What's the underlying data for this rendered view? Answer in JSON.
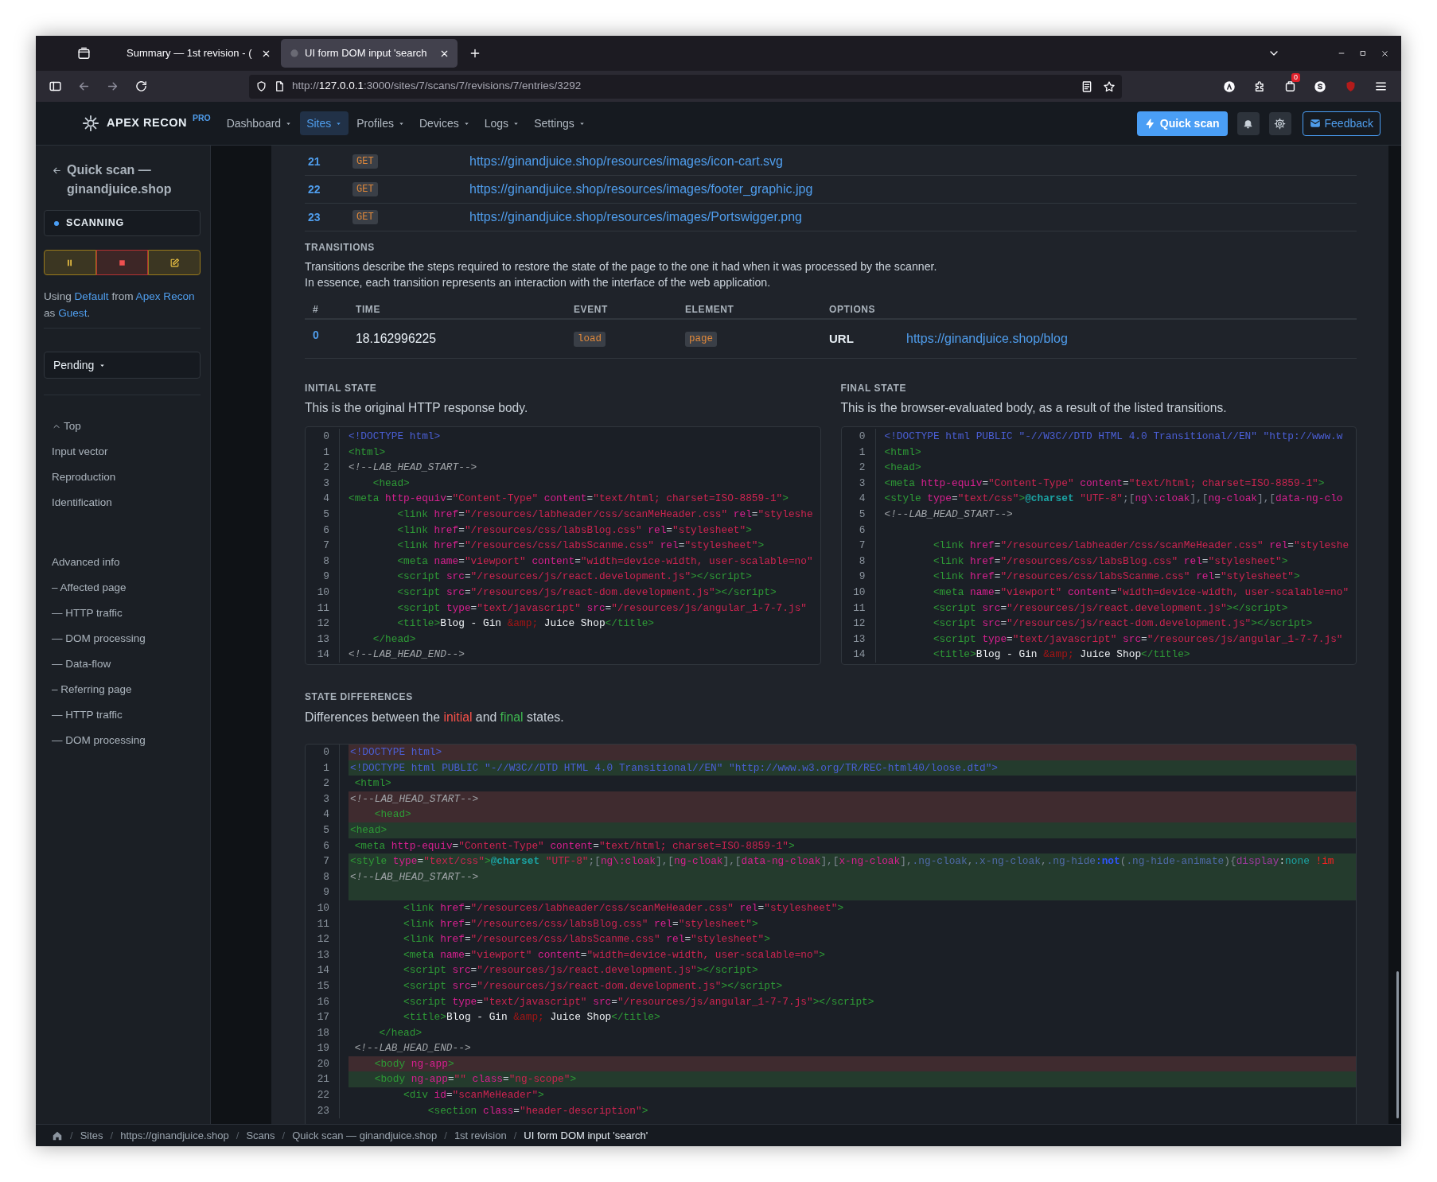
{
  "browser": {
    "tabs": [
      {
        "title": "Summary — 1st revision - (",
        "selected": false
      },
      {
        "title": "UI form DOM input 'search",
        "selected": true
      }
    ],
    "url": {
      "scheme": "http://",
      "host": "127.0.0.1",
      "path": ":3000/sites/7/scans/7/revisions/7/entries/3292"
    },
    "extension_badge": "0"
  },
  "app": {
    "brand": "APEX RECON",
    "edition": "PRO",
    "menu": [
      {
        "label": "Dashboard",
        "selected": false
      },
      {
        "label": "Sites",
        "selected": true
      },
      {
        "label": "Profiles",
        "selected": false
      },
      {
        "label": "Devices",
        "selected": false
      },
      {
        "label": "Logs",
        "selected": false
      },
      {
        "label": "Settings",
        "selected": false
      }
    ],
    "quick_scan": "Quick scan",
    "feedback": "Feedback"
  },
  "sidebar": {
    "title": "Quick scan — ginandjuice.shop",
    "status": "SCANNING",
    "using": [
      {
        "text": "Using ",
        "link": false
      },
      {
        "text": "Default",
        "link": true
      },
      {
        "text": " from ",
        "link": false
      },
      {
        "text": "Apex Recon",
        "link": true
      },
      {
        "text": " as ",
        "link": false
      },
      {
        "text": "Guest",
        "link": true
      },
      {
        "text": ".",
        "link": false
      }
    ],
    "filter": "Pending",
    "sections": [
      {
        "items": [
          {
            "label": "Top",
            "kind": "top"
          },
          {
            "label": "Input vector",
            "kind": "link"
          },
          {
            "label": "Reproduction",
            "kind": "link"
          },
          {
            "label": "Identification",
            "kind": "link"
          }
        ]
      },
      {
        "items": [
          {
            "label": "Advanced info",
            "kind": "link"
          },
          {
            "label": "– Affected page",
            "kind": "link"
          },
          {
            "label": "— HTTP traffic",
            "kind": "link"
          },
          {
            "label": "— DOM processing",
            "kind": "link"
          },
          {
            "label": "— Data-flow",
            "kind": "link"
          },
          {
            "label": "– Referring page",
            "kind": "link"
          },
          {
            "label": "— HTTP traffic",
            "kind": "link"
          },
          {
            "label": "— DOM processing",
            "kind": "link"
          }
        ]
      }
    ]
  },
  "requests": [
    {
      "no": "21",
      "method": "GET",
      "url": "https://ginandjuice.shop/resources/images/icon-cart.svg"
    },
    {
      "no": "22",
      "method": "GET",
      "url": "https://ginandjuice.shop/resources/images/footer_graphic.jpg"
    },
    {
      "no": "23",
      "method": "GET",
      "url": "https://ginandjuice.shop/resources/images/Portswigger.png"
    }
  ],
  "transitions": {
    "heading": "TRANSITIONS",
    "description": [
      "Transitions describe the steps required to restore the state of the page to the one it had when it was processed by the scanner.",
      "In essence, each transition represents an interaction with the interface of the web application."
    ],
    "columns": [
      "#",
      "TIME",
      "EVENT",
      "ELEMENT",
      "OPTIONS"
    ],
    "rows": [
      {
        "index": "0",
        "time": "18.162996225",
        "event": "load",
        "element": "page",
        "option_key": "URL",
        "option_value": "https://ginandjuice.shop/blog"
      }
    ]
  },
  "initial_state": {
    "heading": "INITIAL STATE",
    "description": "This is the original HTTP response body.",
    "lines": [
      {
        "no": "0",
        "code": [
          {
            "kind": "doctype",
            "text": "<!DOCTYPE html>"
          }
        ]
      },
      {
        "no": "1",
        "code": [
          {
            "kind": "tag",
            "text": "<html>"
          }
        ]
      },
      {
        "no": "2",
        "code": [
          {
            "kind": "comment",
            "text": "<!--LAB_HEAD_START-->"
          }
        ]
      },
      {
        "no": "3",
        "code": [
          {
            "kind": "tag",
            "text": "    <head>"
          }
        ]
      },
      {
        "no": "4",
        "code": [
          {
            "kind": "tag",
            "text": "<meta "
          },
          {
            "kind": "attr",
            "text": "http-equiv"
          },
          {
            "kind": "punct",
            "text": "="
          },
          {
            "kind": "value",
            "text": "\"Content-Type\""
          },
          {
            "kind": "attr",
            "text": " content"
          },
          {
            "kind": "punct",
            "text": "="
          },
          {
            "kind": "value",
            "text": "\"text/html; charset=ISO-8859-1\""
          },
          {
            "kind": "tag",
            "text": ">"
          }
        ]
      },
      {
        "no": "5",
        "code": [
          {
            "kind": "tag",
            "text": "        <link "
          },
          {
            "kind": "attr",
            "text": "href"
          },
          {
            "kind": "punct",
            "text": "="
          },
          {
            "kind": "value",
            "text": "\"/resources/labheader/css/scanMeHeader.css\""
          },
          {
            "kind": "attr",
            "text": " rel"
          },
          {
            "kind": "punct",
            "text": "="
          },
          {
            "kind": "value",
            "text": "\"styleshe"
          }
        ]
      },
      {
        "no": "6",
        "code": [
          {
            "kind": "tag",
            "text": "        <link "
          },
          {
            "kind": "attr",
            "text": "href"
          },
          {
            "kind": "punct",
            "text": "="
          },
          {
            "kind": "value",
            "text": "\"/resources/css/labsBlog.css\""
          },
          {
            "kind": "attr",
            "text": " rel"
          },
          {
            "kind": "punct",
            "text": "="
          },
          {
            "kind": "value",
            "text": "\"stylesheet\""
          },
          {
            "kind": "tag",
            "text": ">"
          }
        ]
      },
      {
        "no": "7",
        "code": [
          {
            "kind": "tag",
            "text": "        <link "
          },
          {
            "kind": "attr",
            "text": "href"
          },
          {
            "kind": "punct",
            "text": "="
          },
          {
            "kind": "value",
            "text": "\"/resources/css/labsScanme.css\""
          },
          {
            "kind": "attr",
            "text": " rel"
          },
          {
            "kind": "punct",
            "text": "="
          },
          {
            "kind": "value",
            "text": "\"stylesheet\""
          },
          {
            "kind": "tag",
            "text": ">"
          }
        ]
      },
      {
        "no": "8",
        "code": [
          {
            "kind": "tag",
            "text": "        <meta "
          },
          {
            "kind": "attr",
            "text": "name"
          },
          {
            "kind": "punct",
            "text": "="
          },
          {
            "kind": "value",
            "text": "\"viewport\""
          },
          {
            "kind": "attr",
            "text": " content"
          },
          {
            "kind": "punct",
            "text": "="
          },
          {
            "kind": "value",
            "text": "\"width=device-width, user-scalable=no\""
          }
        ]
      },
      {
        "no": "9",
        "code": [
          {
            "kind": "tag",
            "text": "        <script "
          },
          {
            "kind": "attr",
            "text": "src"
          },
          {
            "kind": "punct",
            "text": "="
          },
          {
            "kind": "value",
            "text": "\"/resources/js/react.development.js\""
          },
          {
            "kind": "tag",
            "text": "></script>"
          }
        ]
      },
      {
        "no": "10",
        "code": [
          {
            "kind": "tag",
            "text": "        <script "
          },
          {
            "kind": "attr",
            "text": "src"
          },
          {
            "kind": "punct",
            "text": "="
          },
          {
            "kind": "value",
            "text": "\"/resources/js/react-dom.development.js\""
          },
          {
            "kind": "tag",
            "text": "></script>"
          }
        ]
      },
      {
        "no": "11",
        "code": [
          {
            "kind": "tag",
            "text": "        <script "
          },
          {
            "kind": "attr",
            "text": "type"
          },
          {
            "kind": "punct",
            "text": "="
          },
          {
            "kind": "value",
            "text": "\"text/javascript\""
          },
          {
            "kind": "attr",
            "text": " src"
          },
          {
            "kind": "punct",
            "text": "="
          },
          {
            "kind": "value",
            "text": "\"/resources/js/angular_1-7-7.js\""
          }
        ]
      },
      {
        "no": "12",
        "code": [
          {
            "kind": "tag",
            "text": "        <title>"
          },
          {
            "kind": "text",
            "text": "Blog - Gin "
          },
          {
            "kind": "entity",
            "text": "&amp;"
          },
          {
            "kind": "text",
            "text": " Juice Shop"
          },
          {
            "kind": "tag",
            "text": "</title>"
          }
        ]
      },
      {
        "no": "13",
        "code": [
          {
            "kind": "tag",
            "text": "    </head>"
          }
        ]
      },
      {
        "no": "14",
        "code": [
          {
            "kind": "comment",
            "text": "<!--LAB_HEAD_END-->"
          }
        ]
      }
    ]
  },
  "final_state": {
    "heading": "FINAL STATE",
    "description": "This is the browser-evaluated body, as a result of the listed transitions.",
    "lines": [
      {
        "no": "0",
        "code": [
          {
            "kind": "doctype",
            "text": "<!DOCTYPE html PUBLIC \"-//W3C//DTD HTML 4.0 Transitional//EN\" \"http://www.w"
          }
        ]
      },
      {
        "no": "1",
        "code": [
          {
            "kind": "tag",
            "text": "<html>"
          }
        ]
      },
      {
        "no": "2",
        "code": [
          {
            "kind": "tag",
            "text": "<head>"
          }
        ]
      },
      {
        "no": "3",
        "code": [
          {
            "kind": "tag",
            "text": "<meta "
          },
          {
            "kind": "attr",
            "text": "http-equiv"
          },
          {
            "kind": "punct",
            "text": "="
          },
          {
            "kind": "value",
            "text": "\"Content-Type\""
          },
          {
            "kind": "attr",
            "text": " content"
          },
          {
            "kind": "punct",
            "text": "="
          },
          {
            "kind": "value",
            "text": "\"text/html; charset=ISO-8859-1\""
          },
          {
            "kind": "tag",
            "text": ">"
          }
        ]
      },
      {
        "no": "4",
        "code": [
          {
            "kind": "tag",
            "text": "<style "
          },
          {
            "kind": "attr",
            "text": "type"
          },
          {
            "kind": "punct",
            "text": "="
          },
          {
            "kind": "value",
            "text": "\"text/css\""
          },
          {
            "kind": "tag",
            "text": ">"
          },
          {
            "kind": "keyword",
            "text": "@charset"
          },
          {
            "kind": "value",
            "text": " \"UTF-8\""
          },
          {
            "kind": "bracket",
            "text": ";["
          },
          {
            "kind": "attr",
            "text": "ng\\:cloak"
          },
          {
            "kind": "bracket",
            "text": "],["
          },
          {
            "kind": "attr",
            "text": "ng-cloak"
          },
          {
            "kind": "bracket",
            "text": "],["
          },
          {
            "kind": "attr",
            "text": "data-ng-clo"
          }
        ]
      },
      {
        "no": "5",
        "code": [
          {
            "kind": "comment",
            "text": "<!--LAB_HEAD_START-->"
          }
        ]
      },
      {
        "no": "6"
      },
      {
        "no": "7",
        "code": [
          {
            "kind": "tag",
            "text": "        <link "
          },
          {
            "kind": "attr",
            "text": "href"
          },
          {
            "kind": "punct",
            "text": "="
          },
          {
            "kind": "value",
            "text": "\"/resources/labheader/css/scanMeHeader.css\""
          },
          {
            "kind": "attr",
            "text": " rel"
          },
          {
            "kind": "punct",
            "text": "="
          },
          {
            "kind": "value",
            "text": "\"styleshe"
          }
        ]
      },
      {
        "no": "8",
        "code": [
          {
            "kind": "tag",
            "text": "        <link "
          },
          {
            "kind": "attr",
            "text": "href"
          },
          {
            "kind": "punct",
            "text": "="
          },
          {
            "kind": "value",
            "text": "\"/resources/css/labsBlog.css\""
          },
          {
            "kind": "attr",
            "text": " rel"
          },
          {
            "kind": "punct",
            "text": "="
          },
          {
            "kind": "value",
            "text": "\"stylesheet\""
          },
          {
            "kind": "tag",
            "text": ">"
          }
        ]
      },
      {
        "no": "9",
        "code": [
          {
            "kind": "tag",
            "text": "        <link "
          },
          {
            "kind": "attr",
            "text": "href"
          },
          {
            "kind": "punct",
            "text": "="
          },
          {
            "kind": "value",
            "text": "\"/resources/css/labsScanme.css\""
          },
          {
            "kind": "attr",
            "text": " rel"
          },
          {
            "kind": "punct",
            "text": "="
          },
          {
            "kind": "value",
            "text": "\"stylesheet\""
          },
          {
            "kind": "tag",
            "text": ">"
          }
        ]
      },
      {
        "no": "10",
        "code": [
          {
            "kind": "tag",
            "text": "        <meta "
          },
          {
            "kind": "attr",
            "text": "name"
          },
          {
            "kind": "punct",
            "text": "="
          },
          {
            "kind": "value",
            "text": "\"viewport\""
          },
          {
            "kind": "attr",
            "text": " content"
          },
          {
            "kind": "punct",
            "text": "="
          },
          {
            "kind": "value",
            "text": "\"width=device-width, user-scalable=no\""
          }
        ]
      },
      {
        "no": "11",
        "code": [
          {
            "kind": "tag",
            "text": "        <script "
          },
          {
            "kind": "attr",
            "text": "src"
          },
          {
            "kind": "punct",
            "text": "="
          },
          {
            "kind": "value",
            "text": "\"/resources/js/react.development.js\""
          },
          {
            "kind": "tag",
            "text": "></script>"
          }
        ]
      },
      {
        "no": "12",
        "code": [
          {
            "kind": "tag",
            "text": "        <script "
          },
          {
            "kind": "attr",
            "text": "src"
          },
          {
            "kind": "punct",
            "text": "="
          },
          {
            "kind": "value",
            "text": "\"/resources/js/react-dom.development.js\""
          },
          {
            "kind": "tag",
            "text": "></script>"
          }
        ]
      },
      {
        "no": "13",
        "code": [
          {
            "kind": "tag",
            "text": "        <script "
          },
          {
            "kind": "attr",
            "text": "type"
          },
          {
            "kind": "punct",
            "text": "="
          },
          {
            "kind": "value",
            "text": "\"text/javascript\""
          },
          {
            "kind": "attr",
            "text": " src"
          },
          {
            "kind": "punct",
            "text": "="
          },
          {
            "kind": "value",
            "text": "\"/resources/js/angular_1-7-7.js\""
          }
        ]
      },
      {
        "no": "14",
        "code": [
          {
            "kind": "tag",
            "text": "        <title>"
          },
          {
            "kind": "text",
            "text": "Blog - Gin "
          },
          {
            "kind": "entity",
            "text": "&amp;"
          },
          {
            "kind": "text",
            "text": " Juice Shop"
          },
          {
            "kind": "tag",
            "text": "</title>"
          }
        ]
      }
    ]
  },
  "state_differences": {
    "heading": "STATE DIFFERENCES",
    "description": [
      {
        "text": "Differences between the ",
        "kind": "plain"
      },
      {
        "text": "initial",
        "kind": "removed"
      },
      {
        "text": " and ",
        "kind": "plain"
      },
      {
        "text": "final",
        "kind": "added"
      },
      {
        "text": " states.",
        "kind": "plain"
      }
    ],
    "lines": [
      {
        "no": "0",
        "kind": "removed",
        "code": [
          {
            "kind": "doctype",
            "text": "<!DOCTYPE html>"
          }
        ]
      },
      {
        "no": "1",
        "kind": "added",
        "code": [
          {
            "kind": "doctype",
            "text": "<!DOCTYPE html PUBLIC \"-//W3C//DTD HTML 4.0 Transitional//EN\" \"http://www.w3.org/TR/REC-html40/loose.dtd\">"
          }
        ]
      },
      {
        "no": "2",
        "kind": "same",
        "code": [
          {
            "kind": "tag",
            "text": " <html>"
          }
        ]
      },
      {
        "no": "3",
        "kind": "removed",
        "code": [
          {
            "kind": "comment",
            "text": "<!--LAB_HEAD_START-->"
          }
        ]
      },
      {
        "no": "4",
        "kind": "removed",
        "code": [
          {
            "kind": "tag",
            "text": "    <head>"
          }
        ]
      },
      {
        "no": "5",
        "kind": "added",
        "code": [
          {
            "kind": "tag",
            "text": "<head>"
          }
        ]
      },
      {
        "no": "6",
        "kind": "same",
        "code": [
          {
            "kind": "tag",
            "text": " <meta "
          },
          {
            "kind": "attr",
            "text": "http-equiv"
          },
          {
            "kind": "punct",
            "text": "="
          },
          {
            "kind": "value",
            "text": "\"Content-Type\""
          },
          {
            "kind": "attr",
            "text": " content"
          },
          {
            "kind": "punct",
            "text": "="
          },
          {
            "kind": "value",
            "text": "\"text/html; charset=ISO-8859-1\""
          },
          {
            "kind": "tag",
            "text": ">"
          }
        ]
      },
      {
        "no": "7",
        "kind": "added",
        "code": [
          {
            "kind": "tag",
            "text": "<style "
          },
          {
            "kind": "attr",
            "text": "type"
          },
          {
            "kind": "punct",
            "text": "="
          },
          {
            "kind": "value",
            "text": "\"text/css\""
          },
          {
            "kind": "tag",
            "text": ">"
          },
          {
            "kind": "keyword",
            "text": "@charset"
          },
          {
            "kind": "value",
            "text": " \"UTF-8\""
          },
          {
            "kind": "bracket",
            "text": ";["
          },
          {
            "kind": "attr",
            "text": "ng\\:cloak"
          },
          {
            "kind": "bracket",
            "text": "],["
          },
          {
            "kind": "attr",
            "text": "ng-cloak"
          },
          {
            "kind": "bracket",
            "text": "],["
          },
          {
            "kind": "attr",
            "text": "data-ng-cloak"
          },
          {
            "kind": "bracket",
            "text": "],["
          },
          {
            "kind": "attr",
            "text": "x-ng-cloak"
          },
          {
            "kind": "bracket",
            "text": "],"
          },
          {
            "kind": "selector",
            "text": ".ng-cloak"
          },
          {
            "kind": "bracket",
            "text": ","
          },
          {
            "kind": "selector",
            "text": ".x-ng-cloak"
          },
          {
            "kind": "bracket",
            "text": ","
          },
          {
            "kind": "selector",
            "text": ".ng-hide"
          },
          {
            "kind": "pseudo",
            "text": ":not"
          },
          {
            "kind": "bracket",
            "text": "("
          },
          {
            "kind": "selector",
            "text": ".ng-hide-animate"
          },
          {
            "kind": "bracket",
            "text": "){"
          },
          {
            "kind": "property",
            "text": "display"
          },
          {
            "kind": "punct",
            "text": ":"
          },
          {
            "kind": "constant",
            "text": "none"
          },
          {
            "kind": "important",
            "text": " !im"
          }
        ]
      },
      {
        "no": "8",
        "kind": "added",
        "code": [
          {
            "kind": "comment",
            "text": "<!--LAB_HEAD_START-->"
          }
        ]
      },
      {
        "no": "9",
        "kind": "added"
      },
      {
        "no": "10",
        "kind": "same",
        "code": [
          {
            "kind": "tag",
            "text": "         <link "
          },
          {
            "kind": "attr",
            "text": "href"
          },
          {
            "kind": "punct",
            "text": "="
          },
          {
            "kind": "value",
            "text": "\"/resources/labheader/css/scanMeHeader.css\""
          },
          {
            "kind": "attr",
            "text": " rel"
          },
          {
            "kind": "punct",
            "text": "="
          },
          {
            "kind": "value",
            "text": "\"stylesheet\""
          },
          {
            "kind": "tag",
            "text": ">"
          }
        ]
      },
      {
        "no": "11",
        "kind": "same",
        "code": [
          {
            "kind": "tag",
            "text": "         <link "
          },
          {
            "kind": "attr",
            "text": "href"
          },
          {
            "kind": "punct",
            "text": "="
          },
          {
            "kind": "value",
            "text": "\"/resources/css/labsBlog.css\""
          },
          {
            "kind": "attr",
            "text": " rel"
          },
          {
            "kind": "punct",
            "text": "="
          },
          {
            "kind": "value",
            "text": "\"stylesheet\""
          },
          {
            "kind": "tag",
            "text": ">"
          }
        ]
      },
      {
        "no": "12",
        "kind": "same",
        "code": [
          {
            "kind": "tag",
            "text": "         <link "
          },
          {
            "kind": "attr",
            "text": "href"
          },
          {
            "kind": "punct",
            "text": "="
          },
          {
            "kind": "value",
            "text": "\"/resources/css/labsScanme.css\""
          },
          {
            "kind": "attr",
            "text": " rel"
          },
          {
            "kind": "punct",
            "text": "="
          },
          {
            "kind": "value",
            "text": "\"stylesheet\""
          },
          {
            "kind": "tag",
            "text": ">"
          }
        ]
      },
      {
        "no": "13",
        "kind": "same",
        "code": [
          {
            "kind": "tag",
            "text": "         <meta "
          },
          {
            "kind": "attr",
            "text": "name"
          },
          {
            "kind": "punct",
            "text": "="
          },
          {
            "kind": "value",
            "text": "\"viewport\""
          },
          {
            "kind": "attr",
            "text": " content"
          },
          {
            "kind": "punct",
            "text": "="
          },
          {
            "kind": "value",
            "text": "\"width=device-width, user-scalable=no\""
          },
          {
            "kind": "tag",
            "text": ">"
          }
        ]
      },
      {
        "no": "14",
        "kind": "same",
        "code": [
          {
            "kind": "tag",
            "text": "         <script "
          },
          {
            "kind": "attr",
            "text": "src"
          },
          {
            "kind": "punct",
            "text": "="
          },
          {
            "kind": "value",
            "text": "\"/resources/js/react.development.js\""
          },
          {
            "kind": "tag",
            "text": "></script>"
          }
        ]
      },
      {
        "no": "15",
        "kind": "same",
        "code": [
          {
            "kind": "tag",
            "text": "         <script "
          },
          {
            "kind": "attr",
            "text": "src"
          },
          {
            "kind": "punct",
            "text": "="
          },
          {
            "kind": "value",
            "text": "\"/resources/js/react-dom.development.js\""
          },
          {
            "kind": "tag",
            "text": "></script>"
          }
        ]
      },
      {
        "no": "16",
        "kind": "same",
        "code": [
          {
            "kind": "tag",
            "text": "         <script "
          },
          {
            "kind": "attr",
            "text": "type"
          },
          {
            "kind": "punct",
            "text": "="
          },
          {
            "kind": "value",
            "text": "\"text/javascript\""
          },
          {
            "kind": "attr",
            "text": " src"
          },
          {
            "kind": "punct",
            "text": "="
          },
          {
            "kind": "value",
            "text": "\"/resources/js/angular_1-7-7.js\""
          },
          {
            "kind": "tag",
            "text": "></script>"
          }
        ]
      },
      {
        "no": "17",
        "kind": "same",
        "code": [
          {
            "kind": "tag",
            "text": "         <title>"
          },
          {
            "kind": "text",
            "text": "Blog - Gin "
          },
          {
            "kind": "entity",
            "text": "&amp;"
          },
          {
            "kind": "text",
            "text": " Juice Shop"
          },
          {
            "kind": "tag",
            "text": "</title>"
          }
        ]
      },
      {
        "no": "18",
        "kind": "same",
        "code": [
          {
            "kind": "tag",
            "text": "     </head>"
          }
        ]
      },
      {
        "no": "19",
        "kind": "same",
        "code": [
          {
            "kind": "comment",
            "text": " <!--LAB_HEAD_END-->"
          }
        ]
      },
      {
        "no": "20",
        "kind": "removed",
        "code": [
          {
            "kind": "tag",
            "text": "    <body "
          },
          {
            "kind": "attr",
            "text": "ng-app"
          },
          {
            "kind": "tag",
            "text": ">"
          }
        ]
      },
      {
        "no": "21",
        "kind": "added",
        "code": [
          {
            "kind": "tag",
            "text": "    <body "
          },
          {
            "kind": "attr",
            "text": "ng-app"
          },
          {
            "kind": "punct",
            "text": "="
          },
          {
            "kind": "value",
            "text": "\"\""
          },
          {
            "kind": "attr",
            "text": " class"
          },
          {
            "kind": "punct",
            "text": "="
          },
          {
            "kind": "value",
            "text": "\"ng-scope\""
          },
          {
            "kind": "tag",
            "text": ">"
          }
        ]
      },
      {
        "no": "22",
        "kind": "same",
        "code": [
          {
            "kind": "tag",
            "text": "         <div "
          },
          {
            "kind": "attr",
            "text": "id"
          },
          {
            "kind": "punct",
            "text": "="
          },
          {
            "kind": "value",
            "text": "\"scanMeHeader\""
          },
          {
            "kind": "tag",
            "text": ">"
          }
        ]
      },
      {
        "no": "23",
        "kind": "same",
        "code": [
          {
            "kind": "tag",
            "text": "             <section "
          },
          {
            "kind": "attr",
            "text": "class"
          },
          {
            "kind": "punct",
            "text": "="
          },
          {
            "kind": "value",
            "text": "\"header-description\""
          },
          {
            "kind": "tag",
            "text": ">"
          }
        ]
      }
    ]
  },
  "breadcrumbs": {
    "separator": "/",
    "items": [
      {
        "label": "Sites",
        "current": false
      },
      {
        "label": "https://ginandjuice.shop",
        "current": false
      },
      {
        "label": "Scans",
        "current": false
      },
      {
        "label": "Quick scan — ginandjuice.shop",
        "current": false
      },
      {
        "label": "1st revision",
        "current": false
      },
      {
        "label": "UI form DOM input 'search'",
        "current": true
      }
    ]
  }
}
